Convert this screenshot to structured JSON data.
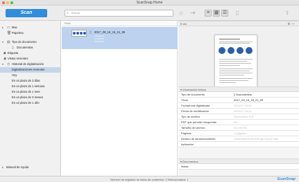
{
  "window": {
    "title": "ScanSnap Home"
  },
  "toolbar": {
    "scan_label": "Scan",
    "search_placeholder": "Buscar"
  },
  "sidebar": {
    "items": [
      {
        "label": "Mac"
      },
      {
        "label": "Papelera"
      },
      {
        "label": "Tipo de documento"
      },
      {
        "label": "Documentos"
      },
      {
        "label": "Etiqueta"
      },
      {
        "label": "Vistos recientes"
      },
      {
        "label": "Historial de digitalización"
      },
      {
        "label": "Digitalizaciones recientes"
      },
      {
        "label": "Hoy"
      },
      {
        "label": "En un plazo de 3 días"
      },
      {
        "label": "En un plazo de 1 semana"
      },
      {
        "label": "En un plazo de 1 mes"
      },
      {
        "label": "En un plazo de 3 meses"
      },
      {
        "label": "En un plazo de 1 año"
      }
    ],
    "help_label": "Manual de Ayuda"
  },
  "list": {
    "header": "Título",
    "items": [
      {
        "name": "2017_09_19_15_21_09"
      }
    ]
  },
  "viewer": {
    "header": "Ver"
  },
  "info": {
    "header": "Información básica",
    "rows": [
      {
        "key": "Tipo de documento",
        "value": "Documentos"
      },
      {
        "key": "Título",
        "value": "2017_09_19_15_21_09"
      },
      {
        "key": "Fecha/hora digitalizada",
        "value": "09/2017 15:21"
      },
      {
        "key": "Fecha de modificación",
        "value": "09/2017 15:21"
      },
      {
        "key": "Tipo de archivo",
        "value": "Documento PDF"
      },
      {
        "key": "PDF que permite búsquedas",
        "value": "No"
      },
      {
        "key": "Tamaño del archivo",
        "value": "523,55 KB"
      },
      {
        "key": "Páginas",
        "value": "1 páginas"
      },
      {
        "key": "Destino de almacenamiento",
        "value": "/Users/admin/ScanSnap Home Data"
      },
      {
        "key": "Aplicación",
        "value": ""
      }
    ]
  },
  "documents_section": {
    "header": "Documentos",
    "notes_label": "Notas"
  },
  "status": {
    "text": "Número de registros de datos de contenido: 1   Seleccionados: 1",
    "brand": "ScanSnap"
  },
  "colors": {
    "accent": "#2f8dd9",
    "selection": "#bcd2ee"
  }
}
